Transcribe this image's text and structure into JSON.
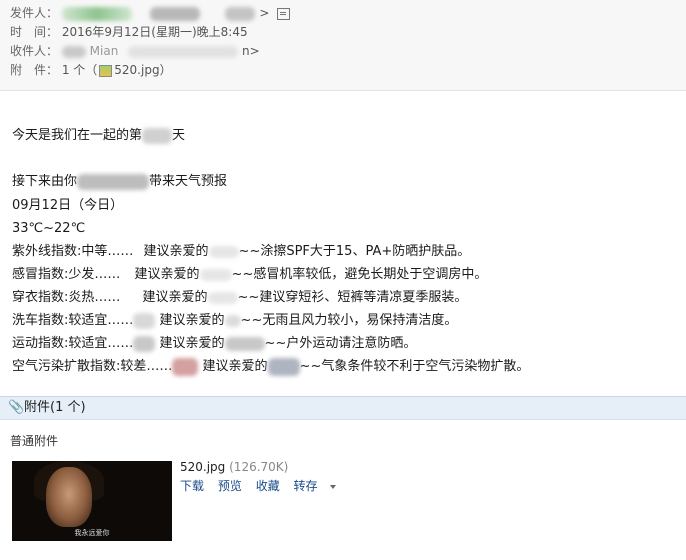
{
  "header": {
    "from_label": "发件人：",
    "from_suffix": ">",
    "time_label": "时　间：",
    "time_value": "2016年9月12日(星期一)晚上8:45",
    "to_label": "收件人：",
    "to_partial": "Mian",
    "to_suffix": "n>",
    "att_label": "附　件：",
    "att_count_prefix": "1 个（",
    "att_file": "520.jpg",
    "att_count_suffix": "）"
  },
  "body": {
    "line1_a": "今天是我们在一起的第",
    "line1_b": "天",
    "line2_a": "接下来由你",
    "line2_b": "带来天气预报",
    "date": "09月12日（今日）",
    "temp": "33℃~22℃",
    "rows": [
      {
        "a": "紫外线指数:中等……",
        "b": "建议亲爱的",
        "c": "~~涂擦SPF大于15、PA+防晒护肤品。"
      },
      {
        "a": "感冒指数:少发……",
        "b": "建议亲爱的",
        "c": "~~感冒机率较低，避免长期处于空调房中。"
      },
      {
        "a": "穿衣指数:炎热……",
        "b": "建议亲爱的",
        "c": "~~建议穿短衫、短裤等清凉夏季服装。"
      },
      {
        "a": "洗车指数:较适宜……",
        "b": "建议亲爱的",
        "c": "~~无雨且风力较小，易保持清洁度。"
      },
      {
        "a": "运动指数:较适宜……",
        "b": "建议亲爱的",
        "c": "~~户外运动请注意防晒。"
      },
      {
        "a": "空气污染扩散指数:较差……",
        "b": "建议亲爱的",
        "c": "~~气象条件较不利于空气污染物扩散。"
      }
    ]
  },
  "attachments": {
    "section_title": "附件(1 个)",
    "plain_label": "普通附件",
    "file_name": "520.jpg",
    "file_size": "(126.70K)",
    "actions": [
      "下载",
      "预览",
      "收藏",
      "转存"
    ],
    "thumb_caption": "我永远爱你"
  }
}
